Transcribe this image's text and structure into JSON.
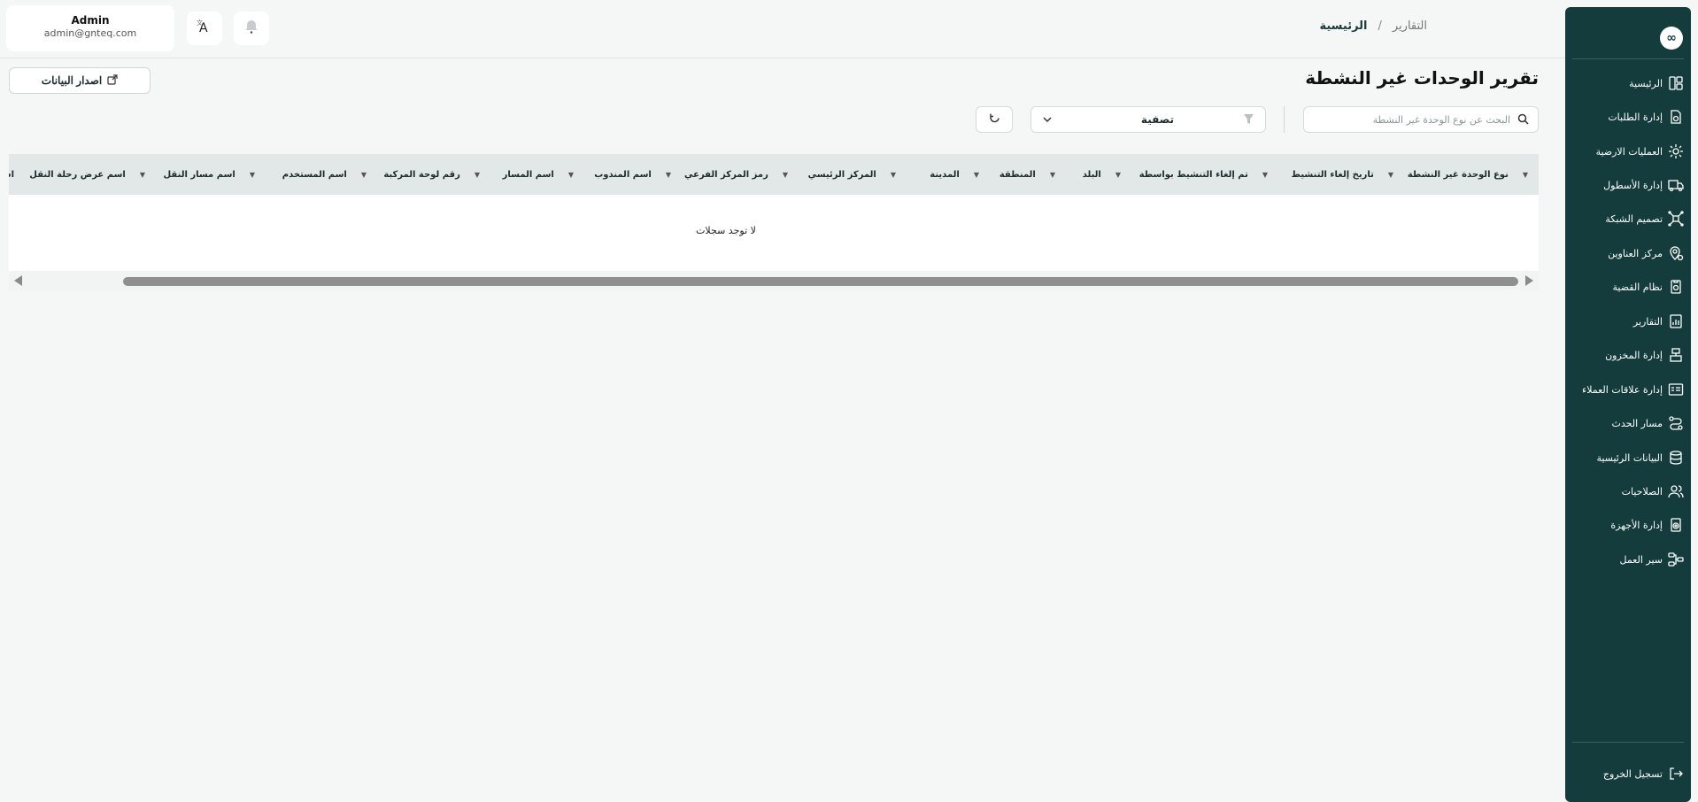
{
  "header": {
    "user_name": "Admin",
    "user_email": "admin@gnteq.com",
    "breadcrumb_home": "الرئيسية",
    "breadcrumb_sep": "/",
    "breadcrumb_current": "التقارير"
  },
  "sidebar": {
    "logo": "∞",
    "items": [
      {
        "label": "الرئيسية",
        "icon": "home-icon"
      },
      {
        "label": "إدارة الطلبات",
        "icon": "orders-icon"
      },
      {
        "label": "العمليات الارضية",
        "icon": "ground-ops-icon"
      },
      {
        "label": "إدارة الأسطول",
        "icon": "fleet-icon"
      },
      {
        "label": "تصميم الشبكة",
        "icon": "network-icon"
      },
      {
        "label": "مركز العناوين",
        "icon": "address-icon"
      },
      {
        "label": "نظام القضية",
        "icon": "case-icon"
      },
      {
        "label": "التقارير",
        "icon": "reports-icon"
      },
      {
        "label": "إدارة المخزون",
        "icon": "inventory-icon"
      },
      {
        "label": "إدارة علاقات العملاء",
        "icon": "crm-icon"
      },
      {
        "label": "مسار الحدث",
        "icon": "event-path-icon"
      },
      {
        "label": "البيانات الرئيسية",
        "icon": "database-icon"
      },
      {
        "label": "الصلاحيات",
        "icon": "users-icon"
      },
      {
        "label": "إدارة الأجهزة",
        "icon": "devices-icon"
      },
      {
        "label": "سير العمل",
        "icon": "workflow-icon"
      }
    ],
    "logout_label": "تسجيل الخروج"
  },
  "main": {
    "title": "تقرير الوحدات غير النشطة",
    "export_label": "اصدار البيانات",
    "search_placeholder": "البحث عن نوع الوحدة غير النشطة",
    "filter_label": "تصفية",
    "columns": [
      "نوع الوحدة غير النشطة",
      "تاريخ إلغاء التنشيط",
      "تم إلغاء التنشيط بواسطة",
      "البلد",
      "المنطقة",
      "المدينة",
      "المركز الرئيسي",
      "رمز المركز الفرعي",
      "اسم المندوب",
      "اسم المسار",
      "رقم لوحة المركبة",
      "اسم المستخدم",
      "اسم مسار النقل",
      "اسم عرض رحلة النقل",
      "اس"
    ],
    "empty_message": "لا توجد سجلات"
  }
}
